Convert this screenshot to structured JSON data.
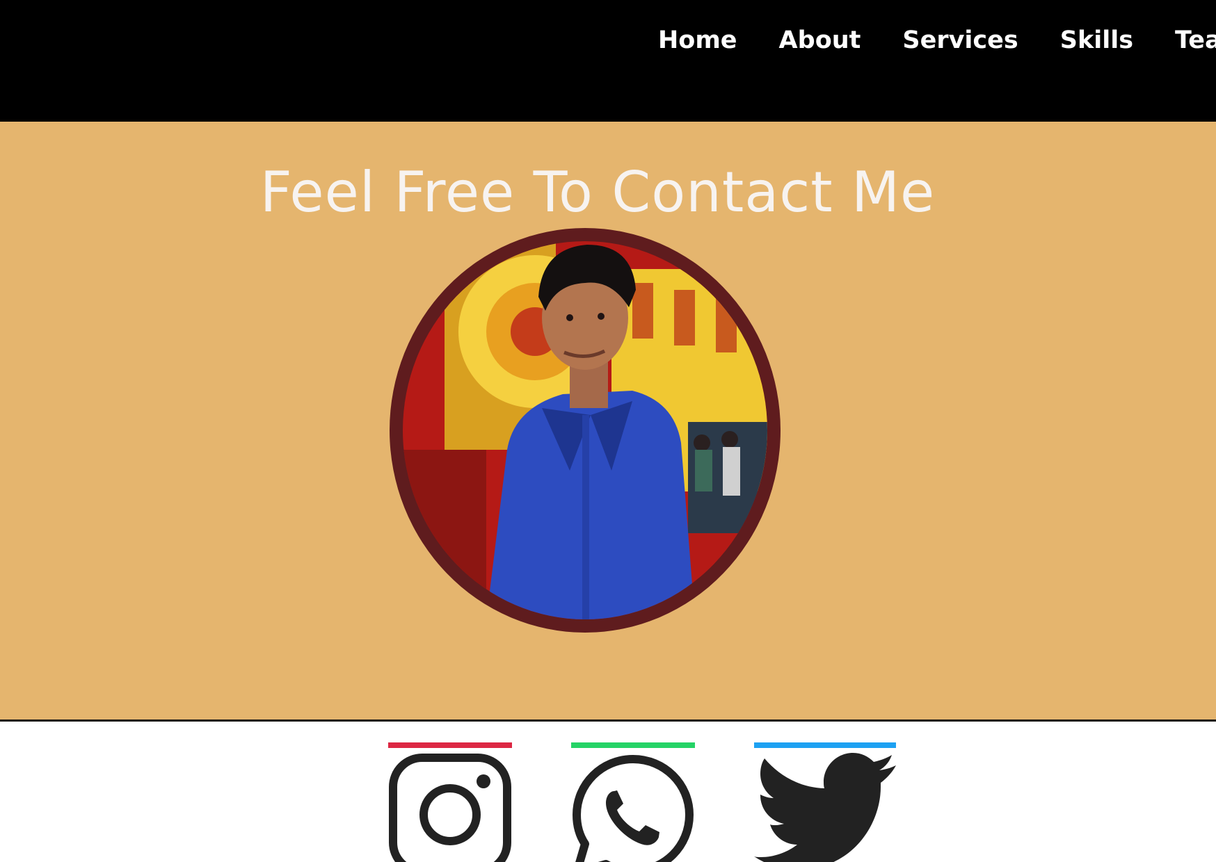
{
  "nav": {
    "items": [
      {
        "label": "Home"
      },
      {
        "label": "About"
      },
      {
        "label": "Services"
      },
      {
        "label": "Skills"
      },
      {
        "label": "Teams"
      }
    ]
  },
  "hero": {
    "title": "Feel Free To Contact Me"
  },
  "social": {
    "items": [
      {
        "name": "instagram",
        "icon": "instagram-icon",
        "accent": "#dc2743"
      },
      {
        "name": "whatsapp",
        "icon": "whatsapp-icon",
        "accent": "#25d366"
      },
      {
        "name": "twitter",
        "icon": "twitter-icon",
        "accent": "#1da1f2"
      }
    ]
  },
  "colors": {
    "navbar": "#000000",
    "hero_background": "#e5b56e",
    "avatar_border": "#5f1c1e",
    "icon": "#222222"
  }
}
